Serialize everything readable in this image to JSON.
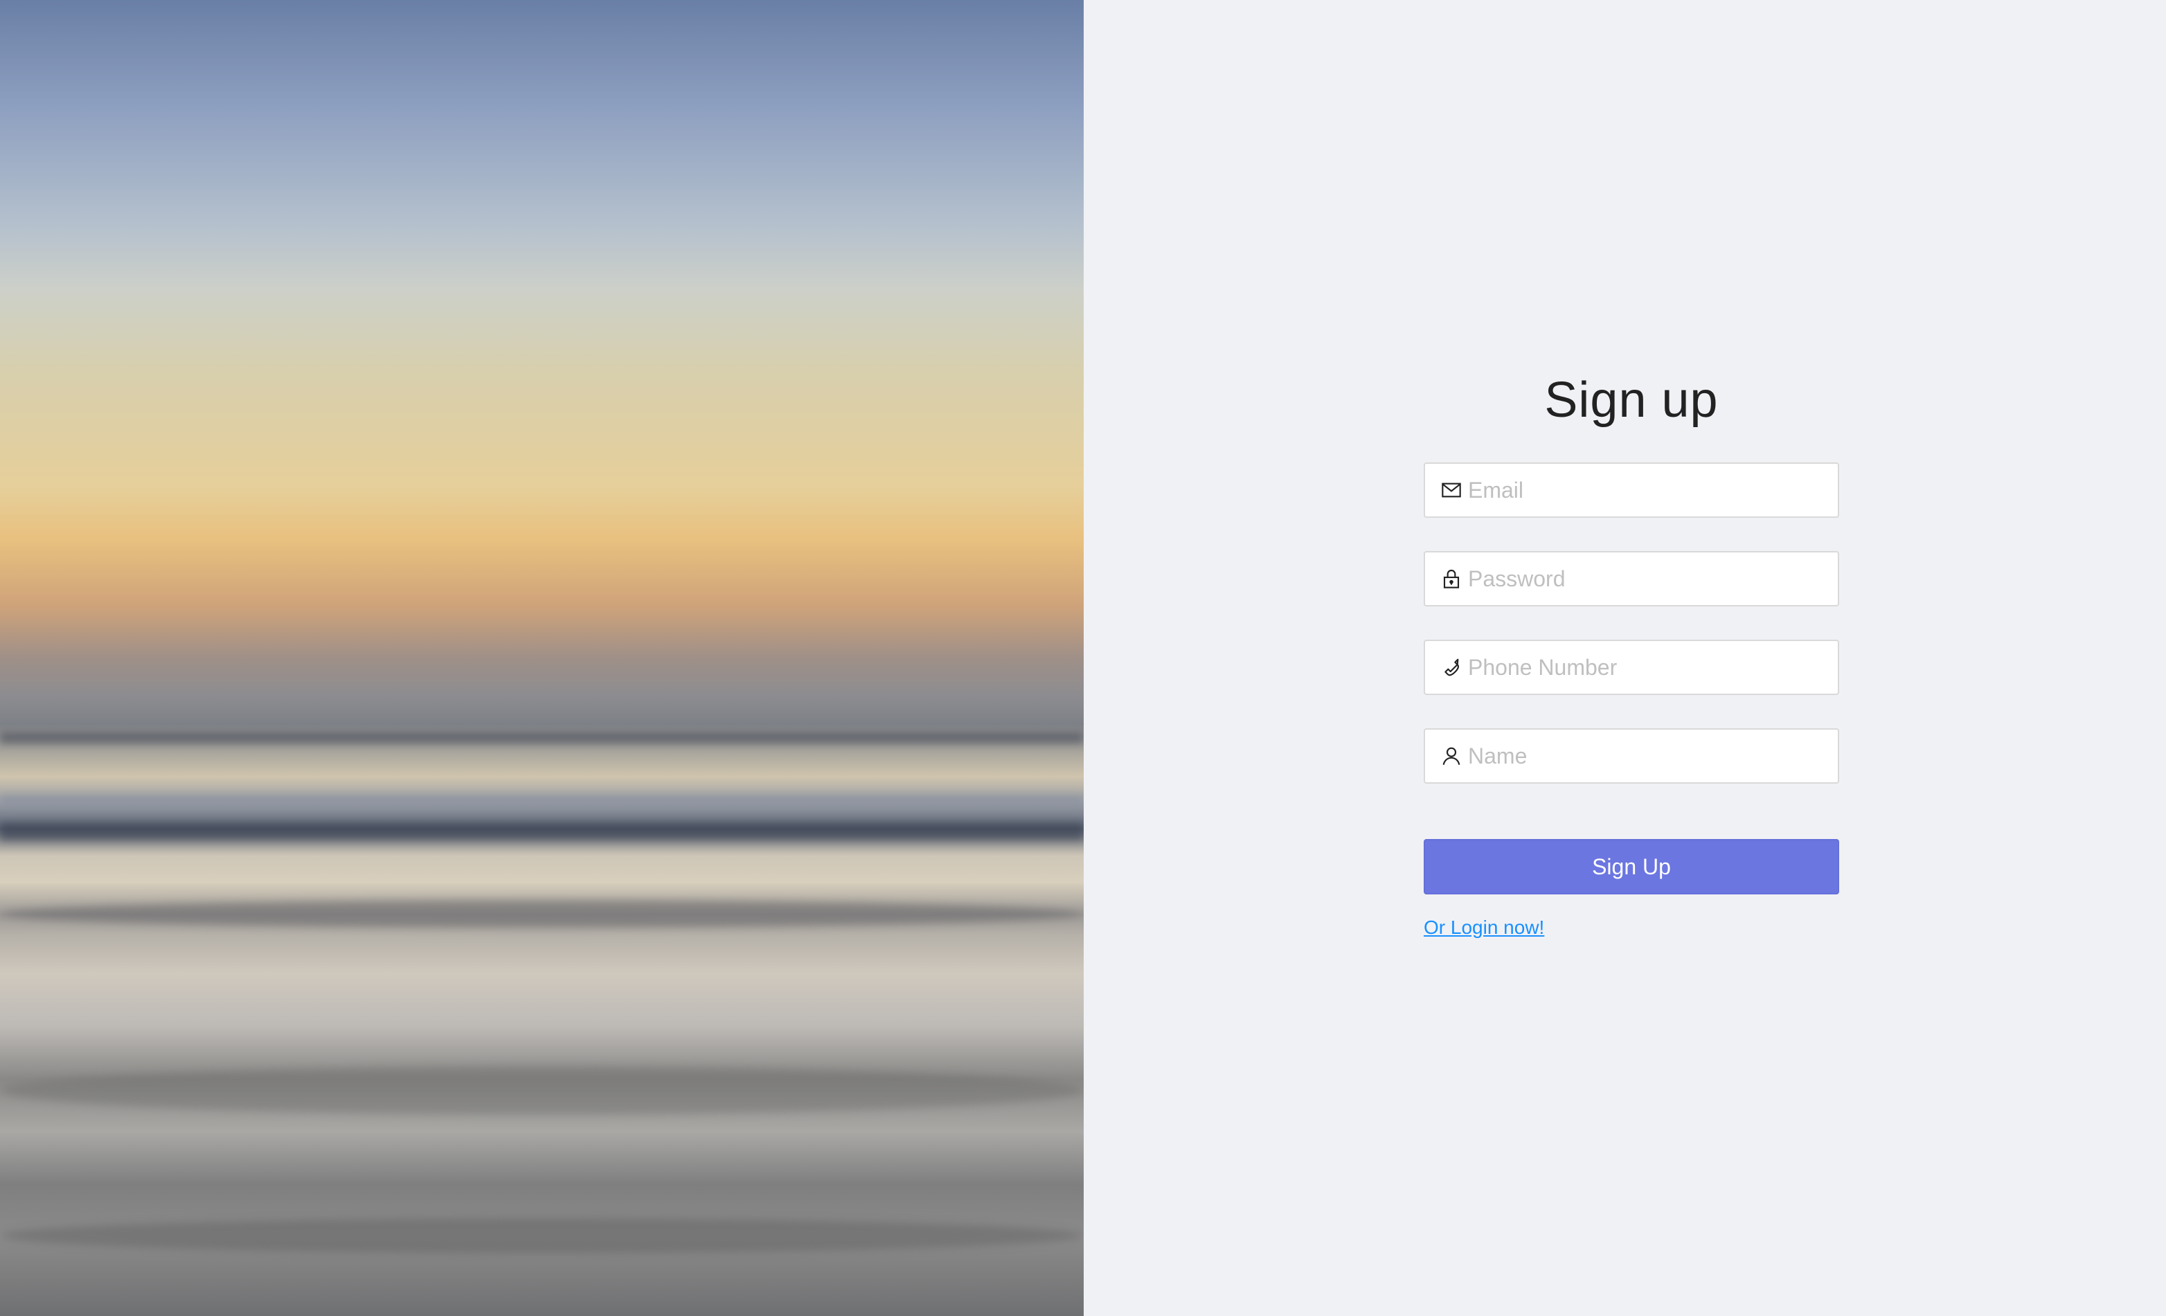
{
  "signup": {
    "title": "Sign up",
    "fields": {
      "email": {
        "placeholder": "Email",
        "icon": "mail-icon"
      },
      "password": {
        "placeholder": "Password",
        "icon": "lock-icon"
      },
      "phone": {
        "placeholder": "Phone Number",
        "icon": "phone-icon"
      },
      "name": {
        "placeholder": "Name",
        "icon": "user-icon"
      }
    },
    "submit_label": "Sign Up",
    "login_link": "Or Login now!"
  },
  "colors": {
    "accent": "#6b76e0",
    "link": "#1890ff",
    "background": "#f0f1f5"
  }
}
